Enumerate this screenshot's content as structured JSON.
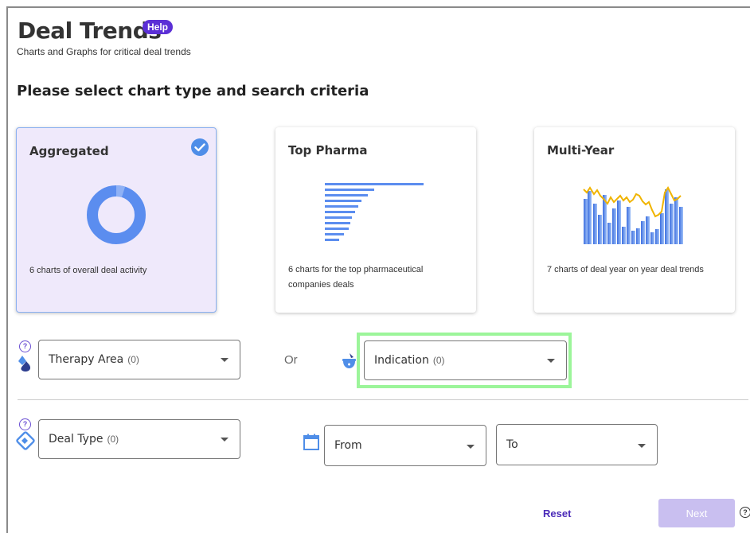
{
  "header": {
    "title": "Deal Trends",
    "help_label": "Help",
    "subtitle": "Charts and Graphs for critical deal trends"
  },
  "section_title": "Please select chart type and search criteria",
  "cards": [
    {
      "title": "Aggregated",
      "description": "6 charts of overall deal activity",
      "selected": true,
      "icon": "donut-chart-icon"
    },
    {
      "title": "Top Pharma",
      "description": "6 charts for the top pharmaceutical companies deals",
      "selected": false,
      "icon": "horizontal-bar-chart-icon"
    },
    {
      "title": "Multi-Year",
      "description": "7 charts of deal year on year deal trends",
      "selected": false,
      "icon": "combo-bar-line-chart-icon"
    }
  ],
  "filters": {
    "help_mark": "?",
    "therapy_area": {
      "label": "Therapy Area",
      "count": "(0)",
      "icon": "therapy-drop-icon"
    },
    "or_label": "Or",
    "indication": {
      "label": "Indication",
      "count": "(0)",
      "icon": "medicine-bowl-icon"
    },
    "deal_type": {
      "label": "Deal Type",
      "count": "(0)",
      "icon": "handshake-icon"
    },
    "from": {
      "label": "From",
      "icon": "calendar-icon"
    },
    "to": {
      "label": "To"
    }
  },
  "footer": {
    "reset_label": "Reset",
    "next_label": "Next",
    "help_mark": "?"
  },
  "colors": {
    "accent_purple": "#5b2fd6",
    "chart_blue": "#5b8def",
    "chart_orange": "#f0b400",
    "selected_card_bg": "#efe9fb",
    "highlight_green": "#9cf59a"
  }
}
